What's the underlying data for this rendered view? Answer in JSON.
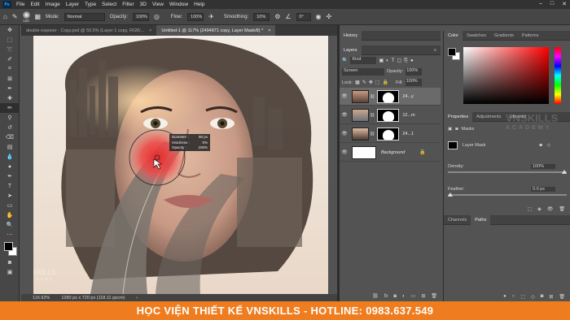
{
  "menubar": {
    "logo": "Ps",
    "items": [
      "File",
      "Edit",
      "Image",
      "Layer",
      "Type",
      "Select",
      "Filter",
      "3D",
      "View",
      "Window",
      "Help"
    ]
  },
  "options": {
    "brush_size": "125",
    "mode_label": "Mode:",
    "mode_value": "Normal",
    "opacity_label": "Opacity:",
    "opacity_value": "100%",
    "flow_label": "Flow:",
    "flow_value": "100%",
    "smoothing_label": "Smoothing:",
    "smoothing_value": "10%",
    "angle_value": "0°"
  },
  "tabs": [
    {
      "label": "double exposer - Copy.psd @ 50.5% (Layer 1 copy, RGB/..."
    },
    {
      "label": "Untitled-1 @ 117% (2494871 copy, Layer Mask/8) *"
    }
  ],
  "brush_tooltip": {
    "diameter_label": "Diameter :",
    "diameter_value": "90 px",
    "hardness_label": "Hardness :",
    "hardness_value": "0%",
    "opacity_label": "Opacity :",
    "opacity_value": "100%"
  },
  "status": {
    "zoom": "116.92%",
    "doc_info": "1280 px x 720 px (118.11 ppcm)"
  },
  "history": {
    "title": "History"
  },
  "layers": {
    "title": "Layers",
    "kind": "Kind",
    "blend": "Screen",
    "opacity_label": "Opacity:",
    "opacity_value": "100%",
    "lock_label": "Lock:",
    "fill_label": "Fill:",
    "fill_value": "100%",
    "items": [
      {
        "name": "24...y"
      },
      {
        "name": "12...m"
      },
      {
        "name": "24...1"
      },
      {
        "name": "Background"
      }
    ]
  },
  "color_panel": {
    "tabs": [
      "Color",
      "Swatches",
      "Gradients",
      "Patterns"
    ]
  },
  "properties": {
    "tabs": [
      "Properties",
      "Adjustments",
      "Libraries"
    ],
    "masks_label": "Masks",
    "layer_mask_label": "Layer Mask",
    "density_label": "Density:",
    "density_value": "100%",
    "feather_label": "Feather:",
    "feather_value": "0.0 px"
  },
  "channels": {
    "tabs": [
      "Channels",
      "Paths"
    ]
  },
  "watermark": {
    "brand": "VNSKILLS",
    "sub": "ACADEMY"
  },
  "banner": {
    "text": "HỌC VIỆN THIẾT KẾ VNSKILLS - HOTLINE: 0983.637.549"
  },
  "colors": {
    "accent_orange": "#ef7d1f",
    "brush_red": "#e52b2b",
    "ps_blue": "#31a8ff"
  }
}
